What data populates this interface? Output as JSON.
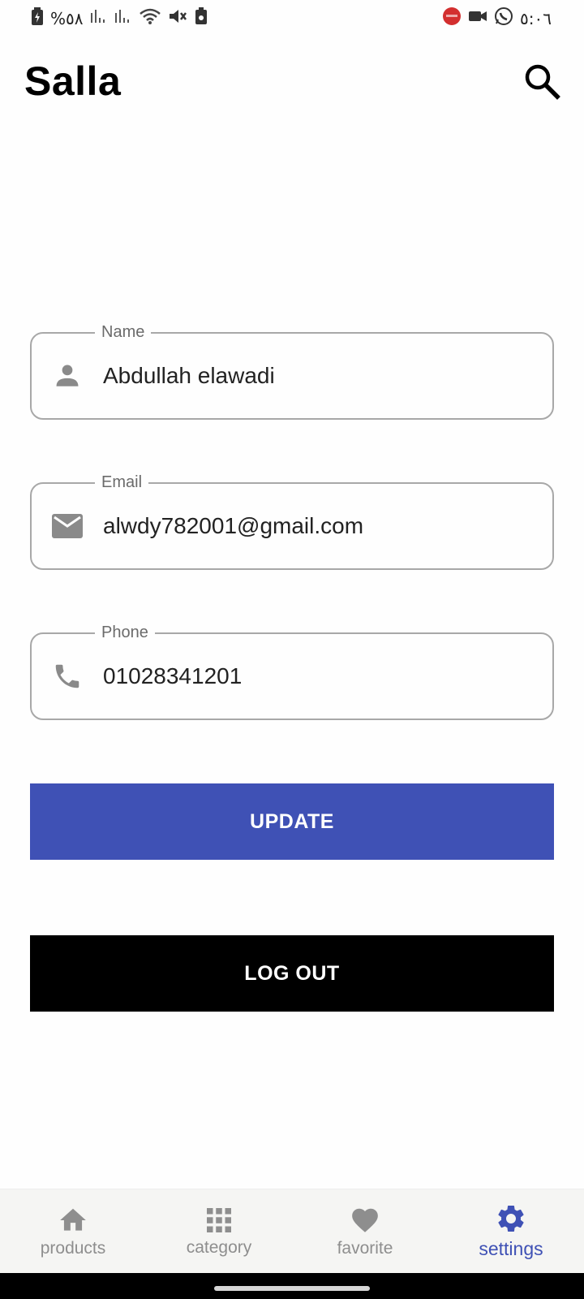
{
  "status_bar": {
    "battery_percent": "%٥٨",
    "time": "٥:٠٦"
  },
  "app_bar": {
    "title": "Salla",
    "search_icon": "search-icon"
  },
  "form": {
    "name": {
      "label": "Name",
      "value": "Abdullah elawadi",
      "icon": "person-icon"
    },
    "email": {
      "label": "Email",
      "value": "alwdy782001@gmail.com",
      "icon": "mail-icon"
    },
    "phone": {
      "label": "Phone",
      "value": "01028341201",
      "icon": "phone-icon"
    }
  },
  "buttons": {
    "update_label": "UPDATE",
    "logout_label": "LOG OUT"
  },
  "bottom_nav": {
    "items": [
      {
        "label": "products",
        "icon": "home-icon",
        "active": false
      },
      {
        "label": "category",
        "icon": "grid-icon",
        "active": false
      },
      {
        "label": "favorite",
        "icon": "heart-icon",
        "active": false
      },
      {
        "label": "settings",
        "icon": "gear-icon",
        "active": true
      }
    ]
  },
  "colors": {
    "accent": "#3f51b5",
    "logout": "#000000",
    "inactive_nav": "#8e8e8e"
  }
}
